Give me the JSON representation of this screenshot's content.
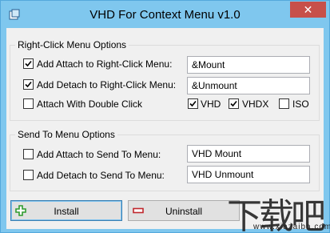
{
  "window": {
    "title": "VHD For Context Menu v1.0",
    "close_glyph": "✕",
    "accent": "#7fc7ee",
    "close_color": "#c7504a"
  },
  "right_click_group": {
    "legend": "Right-Click Menu Options",
    "attach": {
      "checked": true,
      "label": "Add Attach to Right-Click Menu:",
      "value": "&Mount"
    },
    "detach": {
      "checked": true,
      "label": "Add Detach to Right-Click Menu:",
      "value": "&Unmount"
    },
    "double_click": {
      "checked": false,
      "label": "Attach With Double Click"
    },
    "vhd": {
      "checked": true,
      "label": "VHD"
    },
    "vhdx": {
      "checked": true,
      "label": "VHDX"
    },
    "iso": {
      "checked": false,
      "label": "ISO"
    }
  },
  "send_to_group": {
    "legend": "Send To Menu Options",
    "attach": {
      "checked": false,
      "label": "Add Attach to Send To Menu:",
      "value": "VHD Mount"
    },
    "detach": {
      "checked": false,
      "label": "Add Detach to Send To Menu:",
      "value": "VHD Unmount"
    }
  },
  "buttons": {
    "install": {
      "label": "Install",
      "icon": "plus-icon",
      "icon_color": "#2e9b2e"
    },
    "uninstall": {
      "label": "Uninstall",
      "icon": "minus-icon",
      "icon_color": "#c0272d"
    }
  },
  "watermark": {
    "logo_text": "下载吧",
    "url": "www.xiazaiba.com"
  }
}
